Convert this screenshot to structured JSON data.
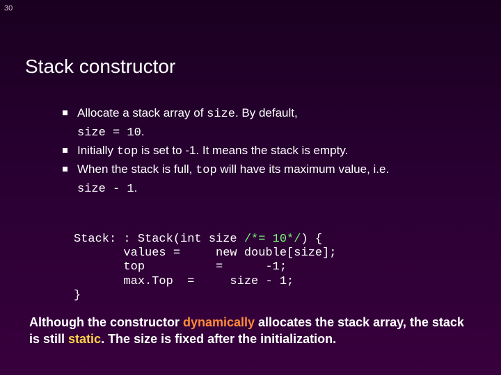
{
  "slide_number": "30",
  "title": "Stack constructor",
  "bullets": {
    "b1_a": "Allocate a stack array of ",
    "b1_code1": "size",
    "b1_b": ". By default,",
    "b1_cont_code": "size = 10",
    "b1_cont_tail": ".",
    "b2_a": "Initially ",
    "b2_code": "top",
    "b2_b": " is set to -1. It means the stack is empty.",
    "b3_a": "When the stack is full, ",
    "b3_code": "top",
    "b3_b": " will have its maximum value, i.e.",
    "b3_cont_code": "size - 1",
    "b3_cont_tail": "."
  },
  "code": {
    "l1_a": "Stack: : Stack(int size ",
    "l1_comment": "/*= 10*/",
    "l1_b": ") {",
    "l2": "       values =     new double[size];",
    "l3": "       top          =      -1;",
    "l4": "       max.Top  =     size - 1;",
    "l5": "}"
  },
  "footer": {
    "f1": "Although the constructor ",
    "f_dyn": "dynamically",
    "f2": " allocates the stack array, the stack is still ",
    "f_static": "static",
    "f3": ". The size is fixed after the initialization."
  }
}
